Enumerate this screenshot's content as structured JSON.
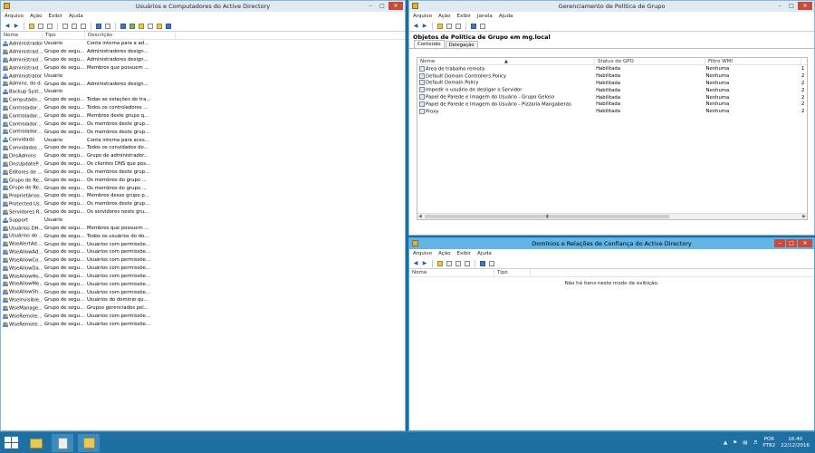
{
  "aduc": {
    "title": "Usuários e Computadores do Active Directory",
    "menu": [
      "Arquivo",
      "Ação",
      "Exibir",
      "Ajuda"
    ],
    "columns": [
      "Nome",
      "Tipo",
      "Descrição"
    ],
    "rows": [
      {
        "icon": "user",
        "name": "Administrador",
        "type": "Usuário",
        "desc": "Conta interna para a ad..."
      },
      {
        "icon": "group",
        "name": "Administrad...",
        "type": "Grupo de segu...",
        "desc": "Administradores design..."
      },
      {
        "icon": "group",
        "name": "Administrad...",
        "type": "Grupo de segu...",
        "desc": "Administradores design..."
      },
      {
        "icon": "group",
        "name": "Administrad...",
        "type": "Grupo de segu...",
        "desc": "Membros que possuem ..."
      },
      {
        "icon": "user",
        "name": "Administrator",
        "type": "Usuário",
        "desc": ""
      },
      {
        "icon": "group",
        "name": "Admins. do d...",
        "type": "Grupo de segu...",
        "desc": "Administradores design..."
      },
      {
        "icon": "user",
        "name": "Backup Syst...",
        "type": "Usuário",
        "desc": ""
      },
      {
        "icon": "group",
        "name": "Computado...",
        "type": "Grupo de segu...",
        "desc": "Todas as estações de tra..."
      },
      {
        "icon": "group",
        "name": "Controlador...",
        "type": "Grupo de segu...",
        "desc": "Todos os controladores ..."
      },
      {
        "icon": "group",
        "name": "Controlador...",
        "type": "Grupo de segu...",
        "desc": "Membros deste grupo q..."
      },
      {
        "icon": "group",
        "name": "Controlador...",
        "type": "Grupo de segu...",
        "desc": "Os membros deste grup..."
      },
      {
        "icon": "group",
        "name": "Controlador...",
        "type": "Grupo de segu...",
        "desc": "Os membros deste grup..."
      },
      {
        "icon": "user",
        "name": "Convidado",
        "type": "Usuário",
        "desc": "Conta interna para aces..."
      },
      {
        "icon": "group",
        "name": "Convidados ...",
        "type": "Grupo de segu...",
        "desc": "Todos os convidados do..."
      },
      {
        "icon": "group",
        "name": "DnsAdmins",
        "type": "Grupo de segu...",
        "desc": "Grupo de administrador..."
      },
      {
        "icon": "group",
        "name": "DnsUpdateP...",
        "type": "Grupo de segu...",
        "desc": "Os clientes DNS que pos..."
      },
      {
        "icon": "group",
        "name": "Editores de ...",
        "type": "Grupo de segu...",
        "desc": "Os membros deste grup..."
      },
      {
        "icon": "group",
        "name": "Grupo de Re...",
        "type": "Grupo de segu...",
        "desc": "Os membros do grupo ..."
      },
      {
        "icon": "group",
        "name": "Grupo de Re...",
        "type": "Grupo de segu...",
        "desc": "Os membros do grupo ..."
      },
      {
        "icon": "group",
        "name": "Proprietários...",
        "type": "Grupo de segu...",
        "desc": "Membros desse grupo p..."
      },
      {
        "icon": "group",
        "name": "Protected Us...",
        "type": "Grupo de segu...",
        "desc": "Os membros deste grup..."
      },
      {
        "icon": "group",
        "name": "Servidores R...",
        "type": "Grupo de segu...",
        "desc": "Os servidores neste gru..."
      },
      {
        "icon": "user",
        "name": "Support",
        "type": "Usuário",
        "desc": ""
      },
      {
        "icon": "group",
        "name": "Usuários DH...",
        "type": "Grupo de segu...",
        "desc": "Membros que possuem ..."
      },
      {
        "icon": "group",
        "name": "Usuários do ...",
        "type": "Grupo de segu...",
        "desc": "Todos os usuários do do..."
      },
      {
        "icon": "group",
        "name": "WseAlertAd...",
        "type": "Grupo de segu...",
        "desc": "Usuários com permissõe..."
      },
      {
        "icon": "group",
        "name": "WseAllowAd...",
        "type": "Grupo de segu...",
        "desc": "Usuários com permissõe..."
      },
      {
        "icon": "group",
        "name": "WseAllowCo...",
        "type": "Grupo de segu...",
        "desc": "Usuários com permissõe..."
      },
      {
        "icon": "group",
        "name": "WseAllowDa...",
        "type": "Grupo de segu...",
        "desc": "Usuários com permissõe..."
      },
      {
        "icon": "group",
        "name": "WseAllowHo...",
        "type": "Grupo de segu...",
        "desc": "Usuários com permissõe..."
      },
      {
        "icon": "group",
        "name": "WseAllowMe...",
        "type": "Grupo de segu...",
        "desc": "Usuários com permissõe..."
      },
      {
        "icon": "group",
        "name": "WseAllowSh...",
        "type": "Grupo de segu...",
        "desc": "Usuários com permissõe..."
      },
      {
        "icon": "group",
        "name": "WseInvisible...",
        "type": "Grupo de segu...",
        "desc": "Usuários do domínio qu..."
      },
      {
        "icon": "group",
        "name": "WseManage...",
        "type": "Grupo de segu...",
        "desc": "Grupos gerenciados pel..."
      },
      {
        "icon": "group",
        "name": "WseRemote...",
        "type": "Grupo de segu...",
        "desc": "Usuários com permissõe..."
      },
      {
        "icon": "group",
        "name": "WseRemote...",
        "type": "Grupo de segu...",
        "desc": "Usuários com permissõe..."
      }
    ]
  },
  "gpm": {
    "title": "Gerenciamento de Política de Grupo",
    "menu": [
      "Arquivo",
      "Ação",
      "Exibir",
      "Janela",
      "Ajuda"
    ],
    "header": "Objetos de Política de Grupo em mg.local",
    "tabs": [
      "Conteúdo",
      "Delegação"
    ],
    "columns": [
      "Nome",
      "Status do GPO",
      "Filtro WMI"
    ],
    "rows": [
      {
        "name": "Área de trabalho remota",
        "status": "Habilitada",
        "wmi": "Nenhuma",
        "extra": "1"
      },
      {
        "name": "Default Domain Controllers Policy",
        "status": "Habilitada",
        "wmi": "Nenhuma",
        "extra": "2"
      },
      {
        "name": "Default Domain Policy",
        "status": "Habilitada",
        "wmi": "Nenhuma",
        "extra": "2"
      },
      {
        "name": "Impedir o usuário de desligar o Servidor",
        "status": "Habilitada",
        "wmi": "Nenhuma",
        "extra": "2"
      },
      {
        "name": "Papel de Parede e Imagem do Usuário - Grupo Geloso",
        "status": "Habilitada",
        "wmi": "Nenhuma",
        "extra": "2"
      },
      {
        "name": "Papel de Parede e Imagem do Usuário - Pizzaria Mangaberas",
        "status": "Habilitada",
        "wmi": "Nenhuma",
        "extra": "2"
      },
      {
        "name": "Proxy",
        "status": "Habilitada",
        "wmi": "Nenhuma",
        "extra": "2"
      }
    ]
  },
  "dom": {
    "title": "Domínios e Relações de Confiança do Active Directory",
    "menu": [
      "Arquivo",
      "Ação",
      "Exibir",
      "Ajuda"
    ],
    "columns": [
      "Nome",
      "Tipo"
    ],
    "empty_message": "Não há itens neste modo de exibição."
  },
  "taskbar": {
    "language": "POR",
    "layout": "PTB2",
    "time": "16:40",
    "date": "22/12/2016"
  },
  "colors": {
    "taskbar": "#1e6fa2",
    "active_title": "#64b4e6",
    "close": "#c94b3b"
  }
}
